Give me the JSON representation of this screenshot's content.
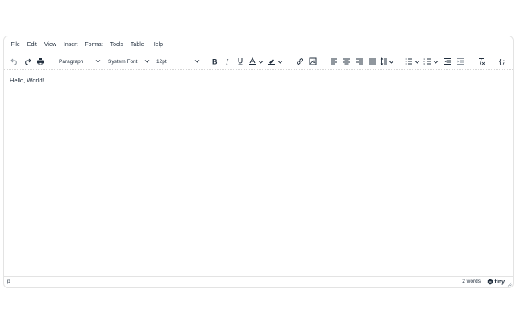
{
  "menubar": {
    "items": [
      {
        "label": "File"
      },
      {
        "label": "Edit"
      },
      {
        "label": "View"
      },
      {
        "label": "Insert"
      },
      {
        "label": "Format"
      },
      {
        "label": "Tools"
      },
      {
        "label": "Table"
      },
      {
        "label": "Help"
      }
    ]
  },
  "toolbar": {
    "block_format": "Paragraph",
    "font_family": "System Font",
    "font_size": "12pt",
    "icons": [
      "undo-icon",
      "redo-icon",
      "print-icon",
      "bold-icon",
      "italic-icon",
      "underline-icon",
      "text-color-icon",
      "highlight-icon",
      "link-icon",
      "image-icon",
      "align-left-icon",
      "align-center-icon",
      "align-right-icon",
      "justify-icon",
      "line-height-icon",
      "bullet-list-icon",
      "numbered-list-icon",
      "outdent-icon",
      "indent-icon",
      "clear-formatting-icon",
      "source-code-icon"
    ]
  },
  "content": {
    "paragraph": "Hello, World!"
  },
  "statusbar": {
    "path": "p",
    "word_count": "2 words",
    "brand": "tiny"
  }
}
